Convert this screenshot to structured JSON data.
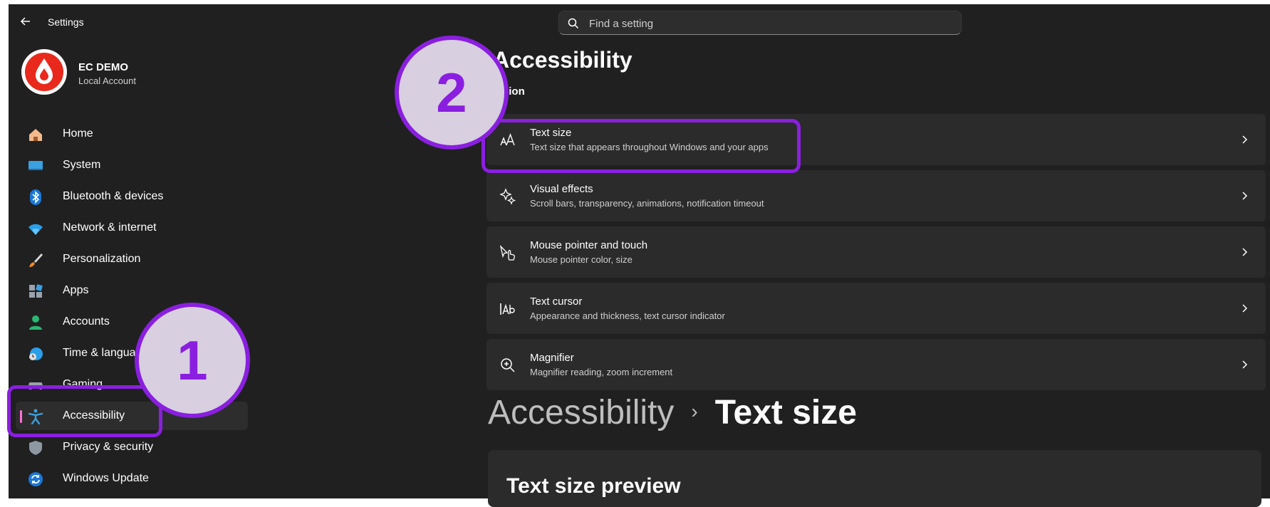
{
  "window": {
    "title": "Settings"
  },
  "search": {
    "placeholder": "Find a setting"
  },
  "account": {
    "name": "EC DEMO",
    "type": "Local Account"
  },
  "nav": {
    "items": [
      {
        "label": "Home",
        "icon": "home-icon"
      },
      {
        "label": "System",
        "icon": "system-icon"
      },
      {
        "label": "Bluetooth & devices",
        "icon": "bluetooth-icon"
      },
      {
        "label": "Network & internet",
        "icon": "wifi-icon"
      },
      {
        "label": "Personalization",
        "icon": "brush-icon"
      },
      {
        "label": "Apps",
        "icon": "apps-icon"
      },
      {
        "label": "Accounts",
        "icon": "person-icon"
      },
      {
        "label": "Time & language",
        "icon": "globe-clock-icon"
      },
      {
        "label": "Gaming",
        "icon": "gamepad-icon"
      },
      {
        "label": "Accessibility",
        "icon": "accessibility-icon",
        "selected": true
      },
      {
        "label": "Privacy & security",
        "icon": "shield-icon"
      },
      {
        "label": "Windows Update",
        "icon": "update-icon"
      }
    ]
  },
  "main": {
    "title": "Accessibility",
    "section": "Vision",
    "cards": [
      {
        "title": "Text size",
        "desc": "Text size that appears throughout Windows and your apps",
        "icon": "text-size-icon"
      },
      {
        "title": "Visual effects",
        "desc": "Scroll bars, transparency, animations, notification timeout",
        "icon": "sparkle-icon"
      },
      {
        "title": "Mouse pointer and touch",
        "desc": "Mouse pointer color, size",
        "icon": "mouse-pointer-icon"
      },
      {
        "title": "Text cursor",
        "desc": "Appearance and thickness, text cursor indicator",
        "icon": "text-cursor-icon"
      },
      {
        "title": "Magnifier",
        "desc": "Magnifier reading, zoom increment",
        "icon": "magnifier-icon"
      }
    ]
  },
  "lower": {
    "breadcrumb_parent": "Accessibility",
    "breadcrumb_separator": "›",
    "breadcrumb_current": "Text size",
    "preview_title": "Text size preview"
  },
  "annotations": {
    "step1": "1",
    "step2": "2",
    "color": "#8a1fe0"
  },
  "colors": {
    "background": "#202020",
    "card": "#2b2b2b",
    "accent": "#ff6fd8"
  }
}
